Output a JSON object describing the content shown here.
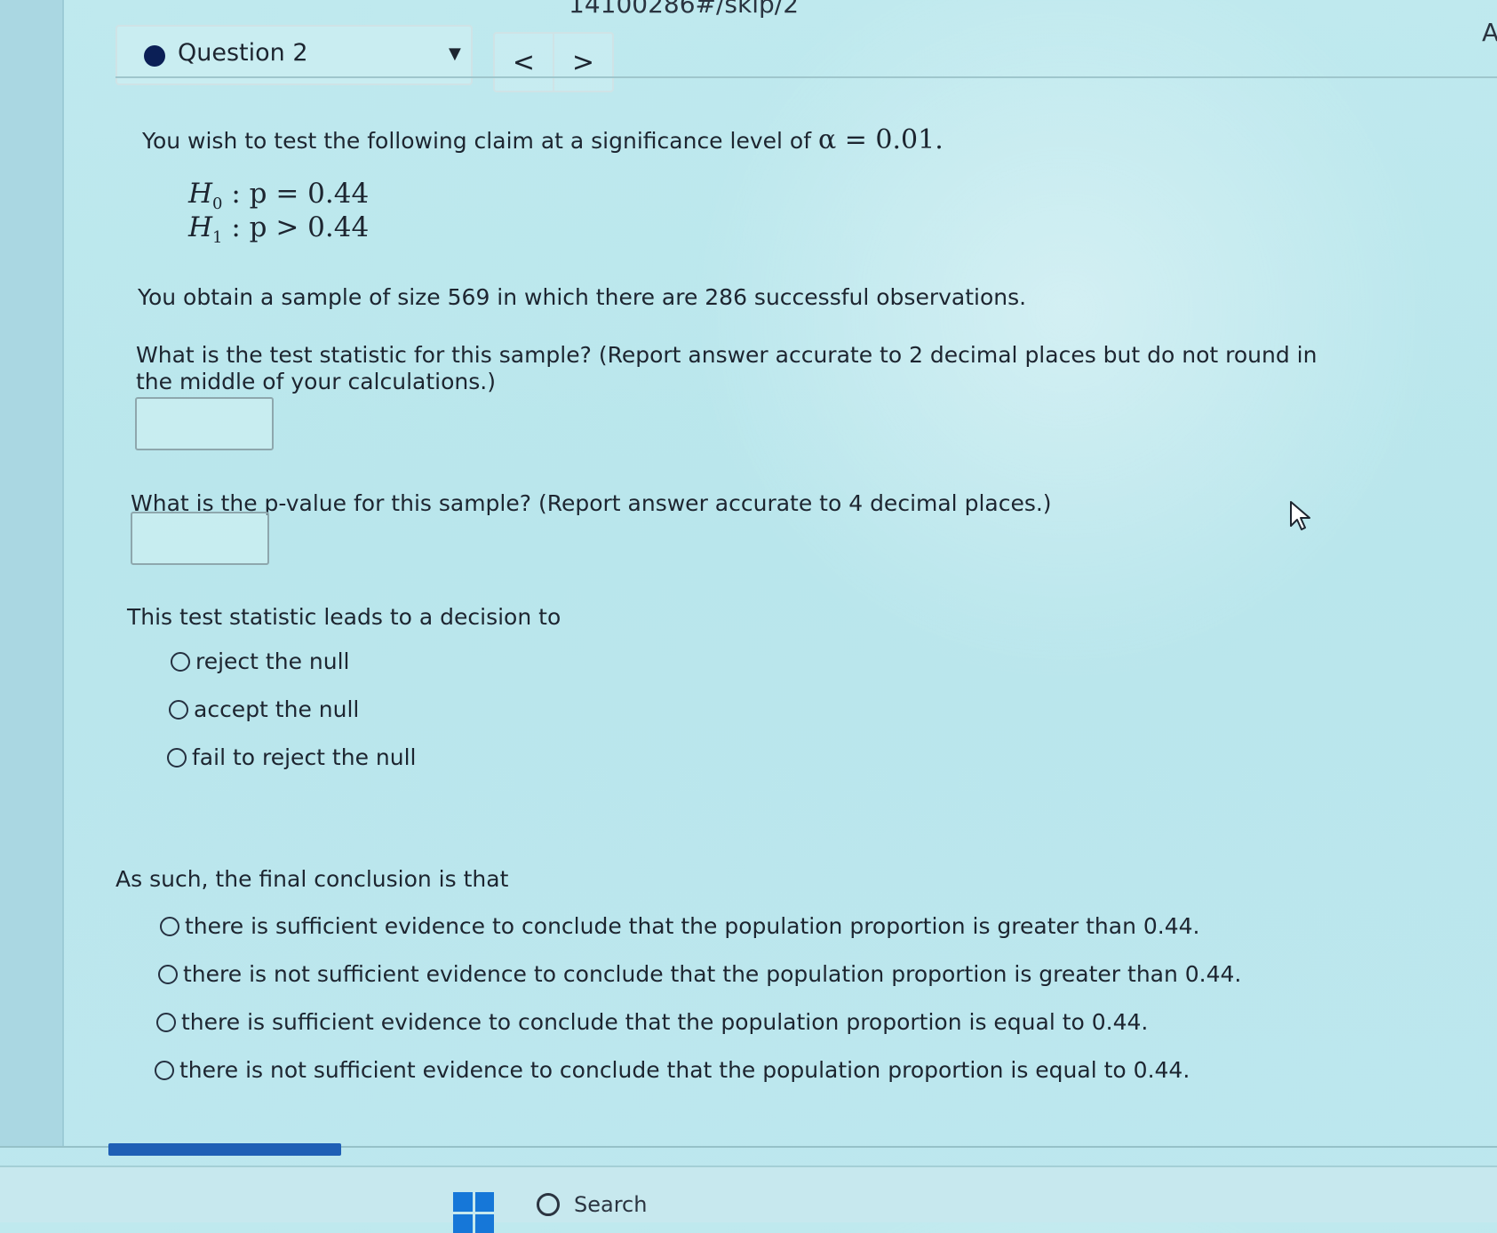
{
  "browser": {
    "url_fragment": "14100286#/skip/2",
    "corner_text": "A"
  },
  "question_header": {
    "title": "Question 2",
    "dropdown_icon": "triangle-down-icon",
    "prev": "<",
    "next": ">",
    "status_color": "#0b1f56"
  },
  "question": {
    "claim_text": "You wish to test the following claim at a significance level of",
    "alpha_expression": "α = 0.01.",
    "h0": {
      "symbol": "H",
      "sub": "0",
      "rest": " : p = 0.44"
    },
    "h1": {
      "symbol": "H",
      "sub": "1",
      "rest": " : p > 0.44"
    },
    "sample_text": "You obtain a sample of size 569 in which there are 286 successful observations.",
    "test_stat_prompt_line1": "What is the test statistic for this sample? (Report answer accurate to 2 decimal places but do not round in",
    "test_stat_prompt_line2": "the middle of your calculations.)",
    "test_stat_value": "",
    "pvalue_prompt": "What is the p-value for this sample? (Report answer accurate to 4 decimal places.)",
    "pvalue_value": "",
    "decision_prompt": "This test statistic leads to a decision to",
    "decision_options": [
      "reject the null",
      "accept the null",
      "fail to reject the null"
    ],
    "conclusion_prompt": "As such, the final conclusion is that",
    "conclusion_options": [
      "there is sufficient evidence to conclude that the population proportion is greater than 0.44.",
      "there is not sufficient evidence to conclude that the population proportion is greater than 0.44.",
      "there is sufficient evidence to conclude that the population proportion is equal to 0.44.",
      "there is not sufficient evidence to conclude that the population proportion is equal to 0.44."
    ]
  },
  "taskbar": {
    "search_label": "Search",
    "windows_icon": "windows-logo-icon",
    "search_icon": "search-icon"
  },
  "colors": {
    "progress": "#1f5fb5",
    "windows_logo": "#1677d8"
  }
}
